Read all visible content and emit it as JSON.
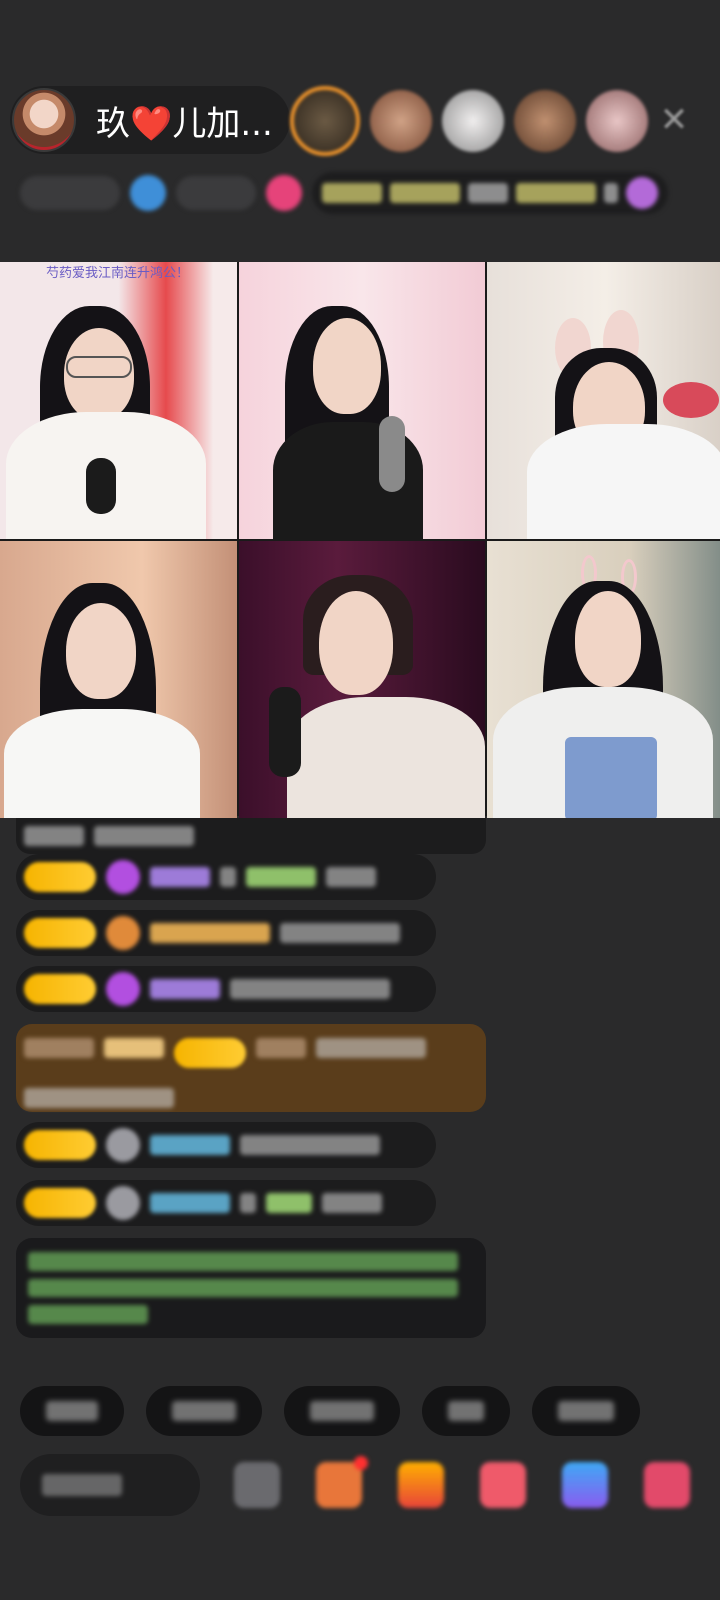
{
  "header": {
    "host_name": "玖❤️儿加...",
    "host_name_plain_prefix": "玖",
    "host_name_heart": "❤️",
    "host_name_suffix": "儿加...",
    "viewers": [
      {
        "name": "viewer-1",
        "color": "#6b5a44"
      },
      {
        "name": "viewer-2",
        "color": "#9a6a55"
      },
      {
        "name": "viewer-3",
        "color": "#c9c4c0"
      },
      {
        "name": "viewer-4",
        "color": "#8e6a4e"
      },
      {
        "name": "viewer-5",
        "color": "#c89b98"
      }
    ],
    "close_icon": "✕"
  },
  "video_grid": {
    "banner_text": "芍药爱我江南连升鸿公！",
    "tiles": [
      {
        "id": "seat-1",
        "mic": true,
        "glasses": true
      },
      {
        "id": "seat-2",
        "mic": true
      },
      {
        "id": "seat-3",
        "ears": true
      },
      {
        "id": "seat-4"
      },
      {
        "id": "seat-5",
        "mic": true
      },
      {
        "id": "seat-6",
        "ears": true
      }
    ]
  },
  "colors": {
    "accent_gold": "#f6b400",
    "highlight_bg": "#5a3d1b",
    "notice_text": "#7fd16b",
    "name_purple": "#9d7bd8",
    "name_blue": "#5aa3c4",
    "name_green": "#8fc06a",
    "name_orange": "#d9a44f"
  }
}
